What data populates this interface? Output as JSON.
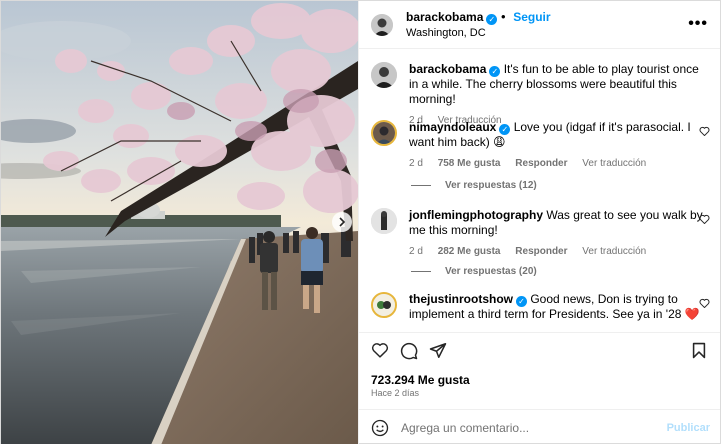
{
  "post": {
    "author": "barackobama",
    "follow_label": "Seguir",
    "location": "Washington, DC",
    "more_label": "•••"
  },
  "caption": {
    "author": "barackobama",
    "text": "It's fun to be able to play tourist once in a while. The cherry blossoms were beautiful this morning!",
    "age": "2 d",
    "translate_label": "Ver traducción"
  },
  "comments": [
    {
      "author": "nimayndoleaux",
      "verified": true,
      "text": "Love you (idgaf if it's parasocial. I want him back) 😩",
      "age": "2 d",
      "likes": "758 Me gusta",
      "reply_label": "Responder",
      "translate_label": "Ver traducción",
      "replies_label": "Ver respuestas (12)"
    },
    {
      "author": "jonflemingphotography",
      "verified": false,
      "text": "Was great to see you walk by me this morning!",
      "age": "2 d",
      "likes": "282 Me gusta",
      "reply_label": "Responder",
      "translate_label": "Ver traducción",
      "replies_label": "Ver respuestas (20)"
    },
    {
      "author": "thejustinrootshow",
      "verified": true,
      "text": "Good news, Don is trying to implement a third term for Presidents. See ya in '28 ❤️"
    }
  ],
  "stats": {
    "likes": "723.294 Me gusta",
    "posted": "Hace 2 días"
  },
  "composer": {
    "placeholder": "Agrega un comentario...",
    "publish_label": "Publicar"
  },
  "colors": {
    "accent": "#0095f6",
    "muted": "#737373",
    "publish_disabled": "#b2dffc"
  }
}
